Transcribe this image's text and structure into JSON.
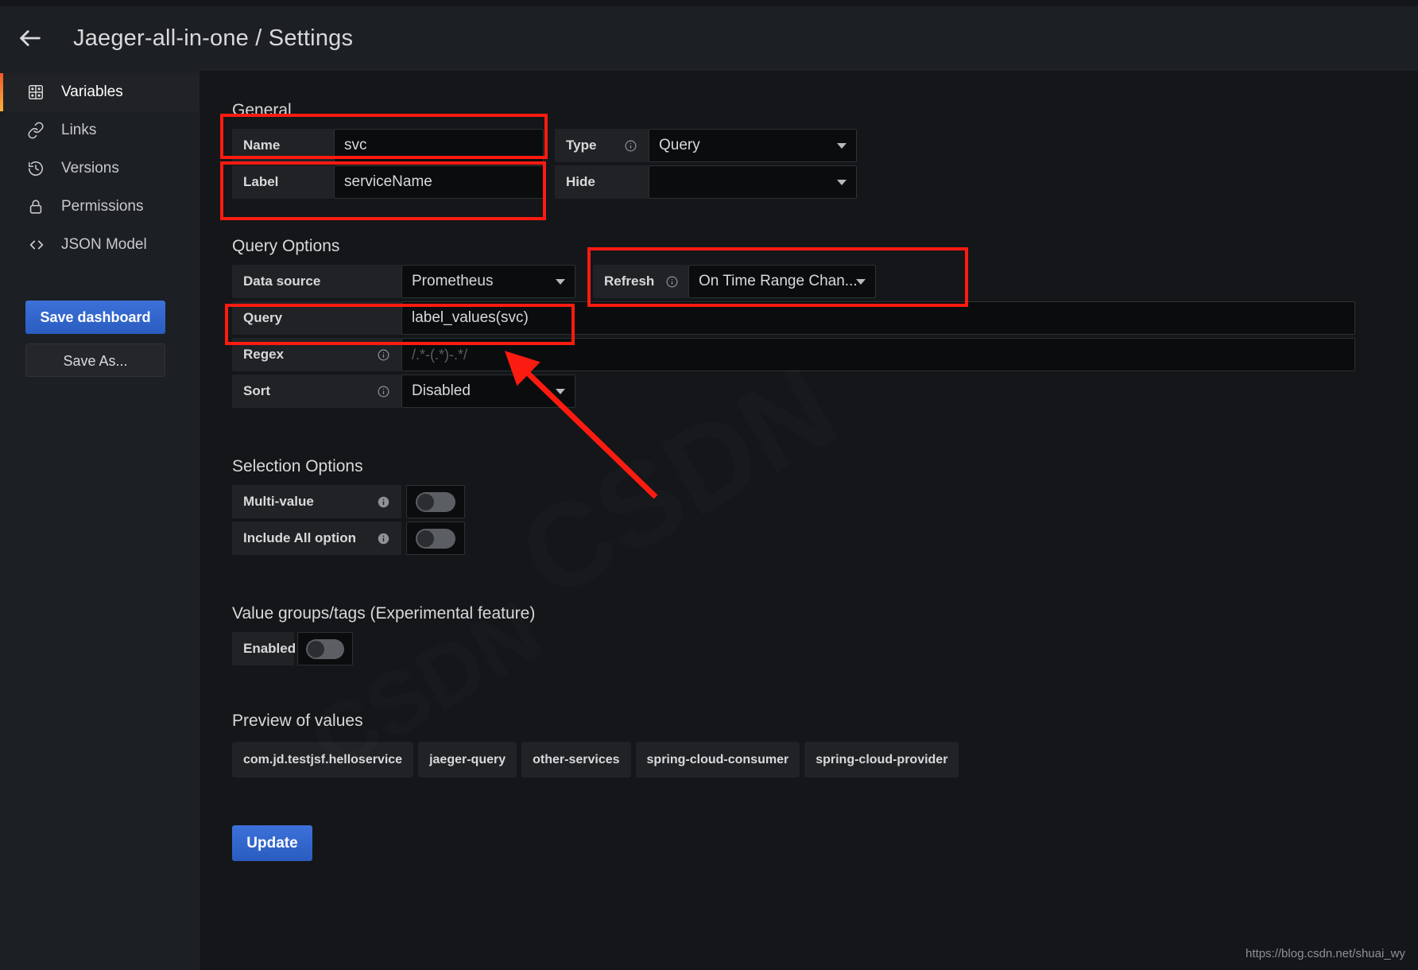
{
  "header": {
    "back_icon": "arrow-left-icon",
    "title": "Jaeger-all-in-one / Settings"
  },
  "sidebar": {
    "items": [
      {
        "label": "Variables",
        "icon": "variables-grid-icon",
        "active": true
      },
      {
        "label": "Links",
        "icon": "link-chain-icon",
        "active": false
      },
      {
        "label": "Versions",
        "icon": "history-clock-icon",
        "active": false
      },
      {
        "label": "Permissions",
        "icon": "lock-icon",
        "active": false
      },
      {
        "label": "JSON Model",
        "icon": "code-brackets-icon",
        "active": false
      }
    ],
    "save_dashboard_label": "Save dashboard",
    "save_as_label": "Save As..."
  },
  "general": {
    "section_title": "General",
    "name_label": "Name",
    "name_value": "svc",
    "label_label": "Label",
    "label_value": "serviceName",
    "type_label": "Type",
    "type_value": "Query",
    "hide_label": "Hide",
    "hide_value": ""
  },
  "query_options": {
    "section_title": "Query Options",
    "datasource_label": "Data source",
    "datasource_value": "Prometheus",
    "refresh_label": "Refresh",
    "refresh_value": "On Time Range Chan...",
    "query_label": "Query",
    "query_value": "label_values(svc)",
    "regex_label": "Regex",
    "regex_placeholder": "/.*-(.*)-.*/",
    "sort_label": "Sort",
    "sort_value": "Disabled"
  },
  "selection_options": {
    "section_title": "Selection Options",
    "multi_value_label": "Multi-value",
    "multi_value_on": false,
    "include_all_label": "Include All option",
    "include_all_on": false
  },
  "value_groups": {
    "section_title": "Value groups/tags (Experimental feature)",
    "enabled_label": "Enabled",
    "enabled_on": false
  },
  "preview": {
    "section_title": "Preview of values",
    "values": [
      "com.jd.testjsf.helloservice",
      "jaeger-query",
      "other-services",
      "spring-cloud-consumer",
      "spring-cloud-provider"
    ]
  },
  "footer": {
    "update_label": "Update",
    "watermark_url": "https://blog.csdn.net/shuai_wy"
  },
  "colors": {
    "accent_blue": "#3d71d9",
    "annotation_red": "#fc1b10",
    "panel_bg": "#1c1f23",
    "content_bg": "#141619",
    "input_bg": "#0b0c0e"
  }
}
